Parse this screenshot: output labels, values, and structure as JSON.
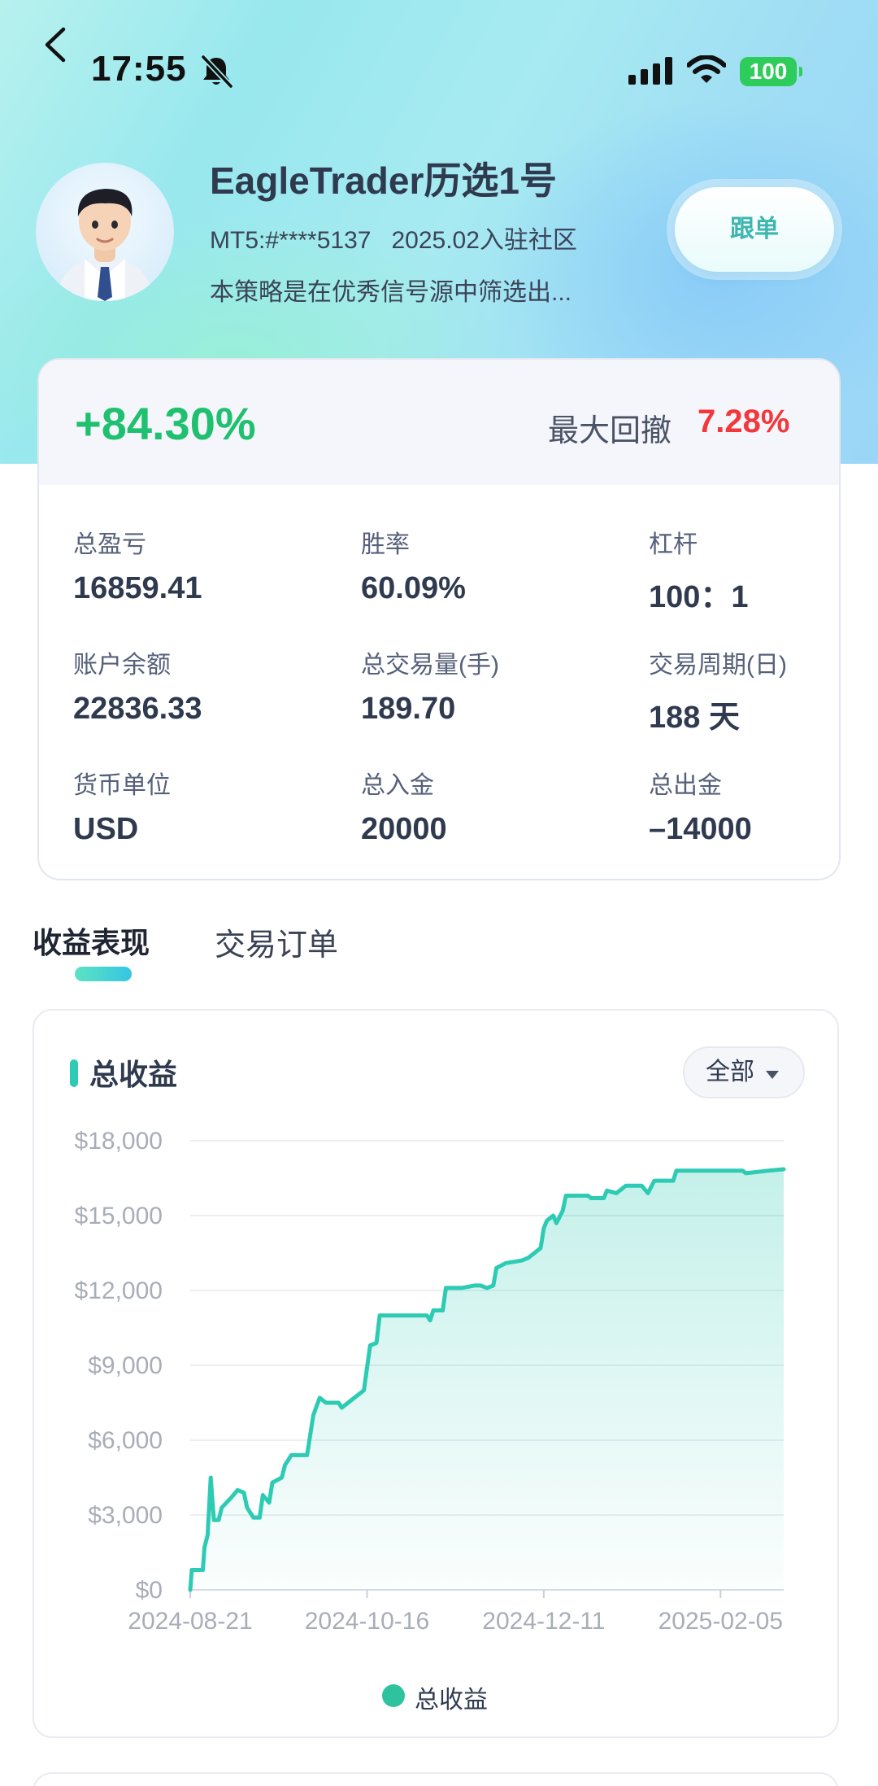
{
  "status_bar": {
    "time": "17:55",
    "battery": "100",
    "icons": [
      "bell-off-icon",
      "signal-icon",
      "wifi-icon",
      "battery-icon"
    ]
  },
  "profile": {
    "name": "EagleTrader历选1号",
    "account": "MT5:#****5137",
    "joined": "2025.02入驻社区",
    "description": "本策略是在优秀信号源中筛选出...",
    "follow_label": "跟单"
  },
  "summary": {
    "return_pct": "+84.30%",
    "max_drawdown_label": "最大回撤",
    "max_drawdown_value": "7.28%",
    "colors": {
      "positive": "#1fc06f",
      "negative": "#f2383b"
    }
  },
  "stats": [
    {
      "label": "总盈亏",
      "value": "16859.41"
    },
    {
      "label": "胜率",
      "value": "60.09%"
    },
    {
      "label": "杠杆",
      "value": "100：1"
    },
    {
      "label": "账户余额",
      "value": "22836.33"
    },
    {
      "label": "总交易量(手)",
      "value": "189.70"
    },
    {
      "label": "交易周期(日)",
      "value": "188 天"
    },
    {
      "label": "货币单位",
      "value": "USD"
    },
    {
      "label": "总入金",
      "value": "20000"
    },
    {
      "label": "总出金",
      "value": "–14000"
    }
  ],
  "tabs": [
    {
      "label": "收益表现",
      "active": true
    },
    {
      "label": "交易订单",
      "active": false
    }
  ],
  "chart_section": {
    "title": "总收益",
    "range_selected": "全部"
  },
  "chart_data": {
    "type": "area",
    "title": "总收益",
    "xlabel": "",
    "ylabel": "",
    "y_ticks": [
      "$0",
      "$3,000",
      "$6,000",
      "$9,000",
      "$12,000",
      "$15,000",
      "$18,000"
    ],
    "x_ticks": [
      "2024-08-21",
      "2024-10-16",
      "2024-12-11",
      "2025-02-05"
    ],
    "x_tick_days": [
      0,
      56,
      112,
      168
    ],
    "ylim": [
      0,
      18000
    ],
    "xlim_days": [
      0,
      188
    ],
    "grid": true,
    "legend_position": "bottom",
    "color": "#2ecbb4",
    "series": [
      {
        "name": "总收益",
        "points": [
          [
            0,
            0
          ],
          [
            0.5,
            800
          ],
          [
            4,
            800
          ],
          [
            4.5,
            1700
          ],
          [
            5.5,
            2200
          ],
          [
            6.5,
            4500
          ],
          [
            7.5,
            2800
          ],
          [
            9,
            2800
          ],
          [
            10,
            3300
          ],
          [
            13,
            3700
          ],
          [
            15,
            4000
          ],
          [
            17,
            3900
          ],
          [
            18,
            3300
          ],
          [
            20,
            2900
          ],
          [
            22,
            2900
          ],
          [
            23,
            3800
          ],
          [
            25,
            3500
          ],
          [
            26,
            4300
          ],
          [
            29,
            4500
          ],
          [
            30,
            5000
          ],
          [
            32,
            5400
          ],
          [
            37,
            5400
          ],
          [
            39,
            7000
          ],
          [
            41,
            7700
          ],
          [
            43,
            7500
          ],
          [
            47,
            7500
          ],
          [
            48,
            7300
          ],
          [
            50,
            7500
          ],
          [
            55,
            8000
          ],
          [
            57,
            9800
          ],
          [
            59,
            9900
          ],
          [
            60,
            11000
          ],
          [
            75,
            11000
          ],
          [
            76,
            10800
          ],
          [
            77,
            11200
          ],
          [
            80,
            11200
          ],
          [
            81,
            12100
          ],
          [
            86,
            12100
          ],
          [
            90,
            12200
          ],
          [
            92,
            12200
          ],
          [
            94,
            12100
          ],
          [
            96,
            12200
          ],
          [
            97,
            12900
          ],
          [
            100,
            13100
          ],
          [
            105,
            13200
          ],
          [
            107,
            13300
          ],
          [
            111,
            13700
          ],
          [
            112,
            14500
          ],
          [
            113,
            14800
          ],
          [
            115,
            15000
          ],
          [
            116,
            14700
          ],
          [
            118,
            15200
          ],
          [
            119,
            15800
          ],
          [
            126,
            15800
          ],
          [
            127,
            15700
          ],
          [
            131,
            15700
          ],
          [
            132,
            16000
          ],
          [
            135,
            15900
          ],
          [
            138,
            16200
          ],
          [
            143,
            16200
          ],
          [
            145,
            15900
          ],
          [
            147,
            16400
          ],
          [
            153,
            16400
          ],
          [
            154,
            16800
          ],
          [
            175,
            16800
          ],
          [
            176,
            16700
          ],
          [
            183,
            16800
          ],
          [
            188,
            16860
          ]
        ]
      }
    ]
  }
}
